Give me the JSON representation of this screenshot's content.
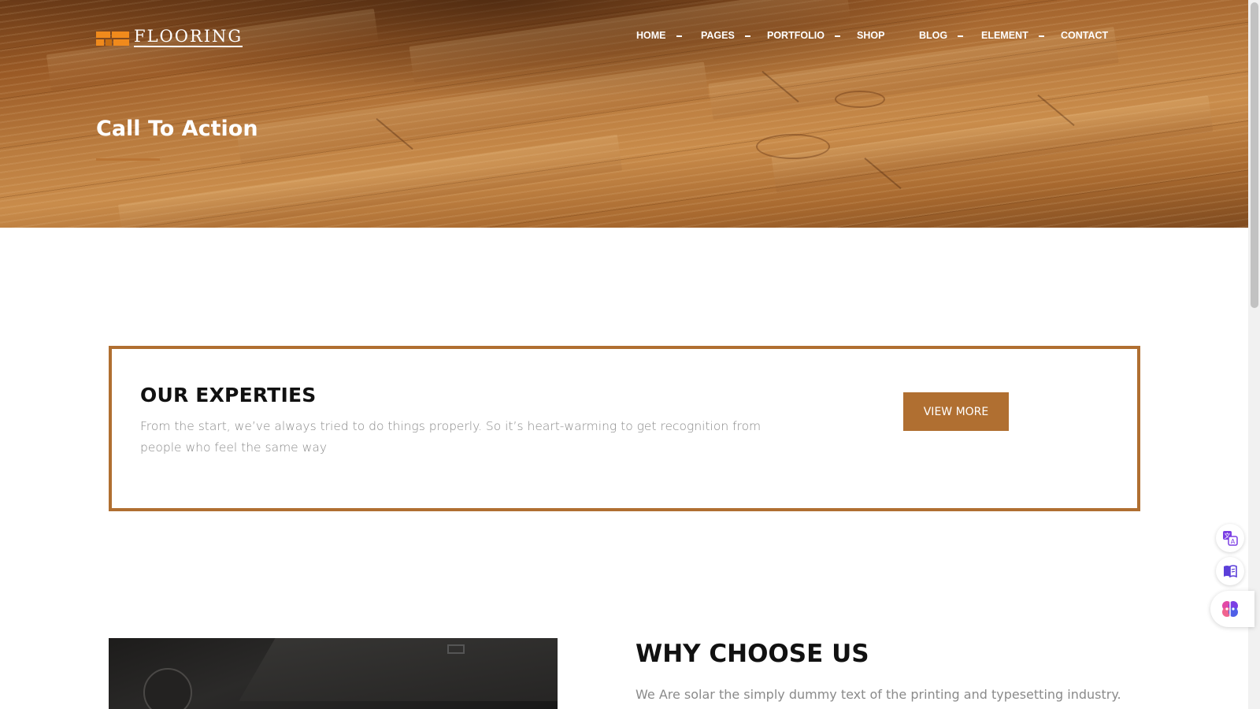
{
  "brand": {
    "logo_text": "FLOORING",
    "accent_color": "#b06f31",
    "logo_mark_color": "#f08a1c"
  },
  "nav": {
    "items": [
      {
        "label": "HOME",
        "has_dropdown": true
      },
      {
        "label": "PAGES",
        "has_dropdown": true
      },
      {
        "label": "PORTFOLIO",
        "has_dropdown": true
      },
      {
        "label": "SHOP",
        "has_dropdown": false
      },
      {
        "label": "BLOG",
        "has_dropdown": true
      },
      {
        "label": "ELEMENT",
        "has_dropdown": true
      },
      {
        "label": "CONTACT",
        "has_dropdown": false
      }
    ]
  },
  "hero": {
    "title": "Call To Action"
  },
  "cta": {
    "heading": "OUR EXPERTIES",
    "text": "From the start, we’ve always tried to do things properly. So it’s heart-warming to get recognition from people who feel the same way",
    "button_label": "VIEW MORE"
  },
  "why": {
    "heading": "WHY CHOOSE US",
    "text": "We Are solar the simply dummy text of the printing and typesetting industry. Lorem"
  },
  "floating_tools": [
    {
      "icon": "translate-icon"
    },
    {
      "icon": "reader-icon"
    },
    {
      "icon": "ai-brain-icon"
    }
  ]
}
